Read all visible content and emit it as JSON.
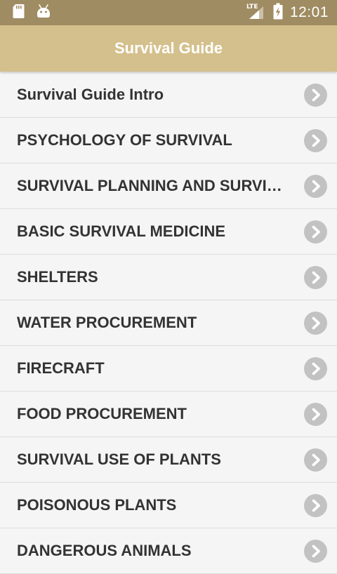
{
  "status_bar": {
    "time": "12:01",
    "network_label": "LTE",
    "icons": [
      "sd-card-icon",
      "android-icon",
      "lte-signal-icon",
      "battery-charging-icon"
    ]
  },
  "app_bar": {
    "title": "Survival Guide"
  },
  "colors": {
    "status_bar": "#a08c62",
    "app_bar": "#d4c08c",
    "list_background": "#f5f5f5",
    "chevron": "#c2c2c2",
    "text": "#333333"
  },
  "list": {
    "items": [
      {
        "label": "Survival Guide Intro"
      },
      {
        "label": "PSYCHOLOGY OF SURVIVAL"
      },
      {
        "label": "SURVIVAL PLANNING AND SURVIVAL KITS"
      },
      {
        "label": "BASIC SURVIVAL MEDICINE"
      },
      {
        "label": "SHELTERS"
      },
      {
        "label": "WATER PROCUREMENT"
      },
      {
        "label": "FIRECRAFT"
      },
      {
        "label": "FOOD PROCUREMENT"
      },
      {
        "label": "SURVIVAL USE OF PLANTS"
      },
      {
        "label": "POISONOUS PLANTS"
      },
      {
        "label": "DANGEROUS ANIMALS"
      }
    ]
  }
}
